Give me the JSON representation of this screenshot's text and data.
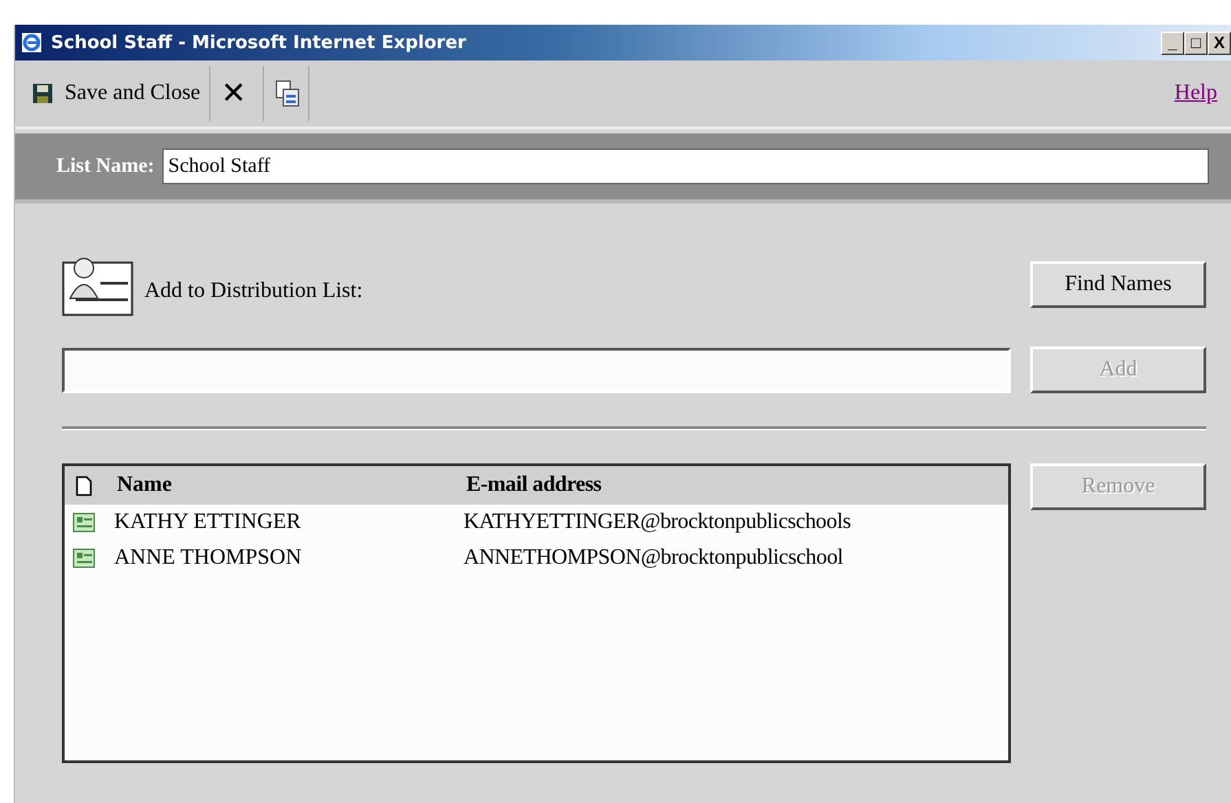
{
  "window": {
    "title": "School Staff - Microsoft Internet Explorer",
    "controls": [
      "_",
      "□",
      "X"
    ]
  },
  "toolbar": {
    "save": "Save and Close",
    "delete": "✕",
    "help": "Help"
  },
  "list_name": {
    "label": "List Name:",
    "value": "School Staff"
  },
  "add_section": {
    "label": "Add to Distribution List:",
    "find_button": {
      "label": "Find Names",
      "disabled": false
    },
    "add_button": {
      "label": "Add",
      "disabled": true
    }
  },
  "members": {
    "columns": [
      "Name",
      "E-mail address"
    ],
    "rows": [
      {
        "name": "KATHY ETTINGER",
        "email": "KATHYETTINGER@brocktonpublicschools",
        "selected": false
      },
      {
        "name": "ANNE THOMPSON",
        "email": "ANNETHOMPSON@brocktonpublicschool",
        "selected": false
      }
    ],
    "remove_button": {
      "label": "Remove",
      "disabled": true
    }
  }
}
